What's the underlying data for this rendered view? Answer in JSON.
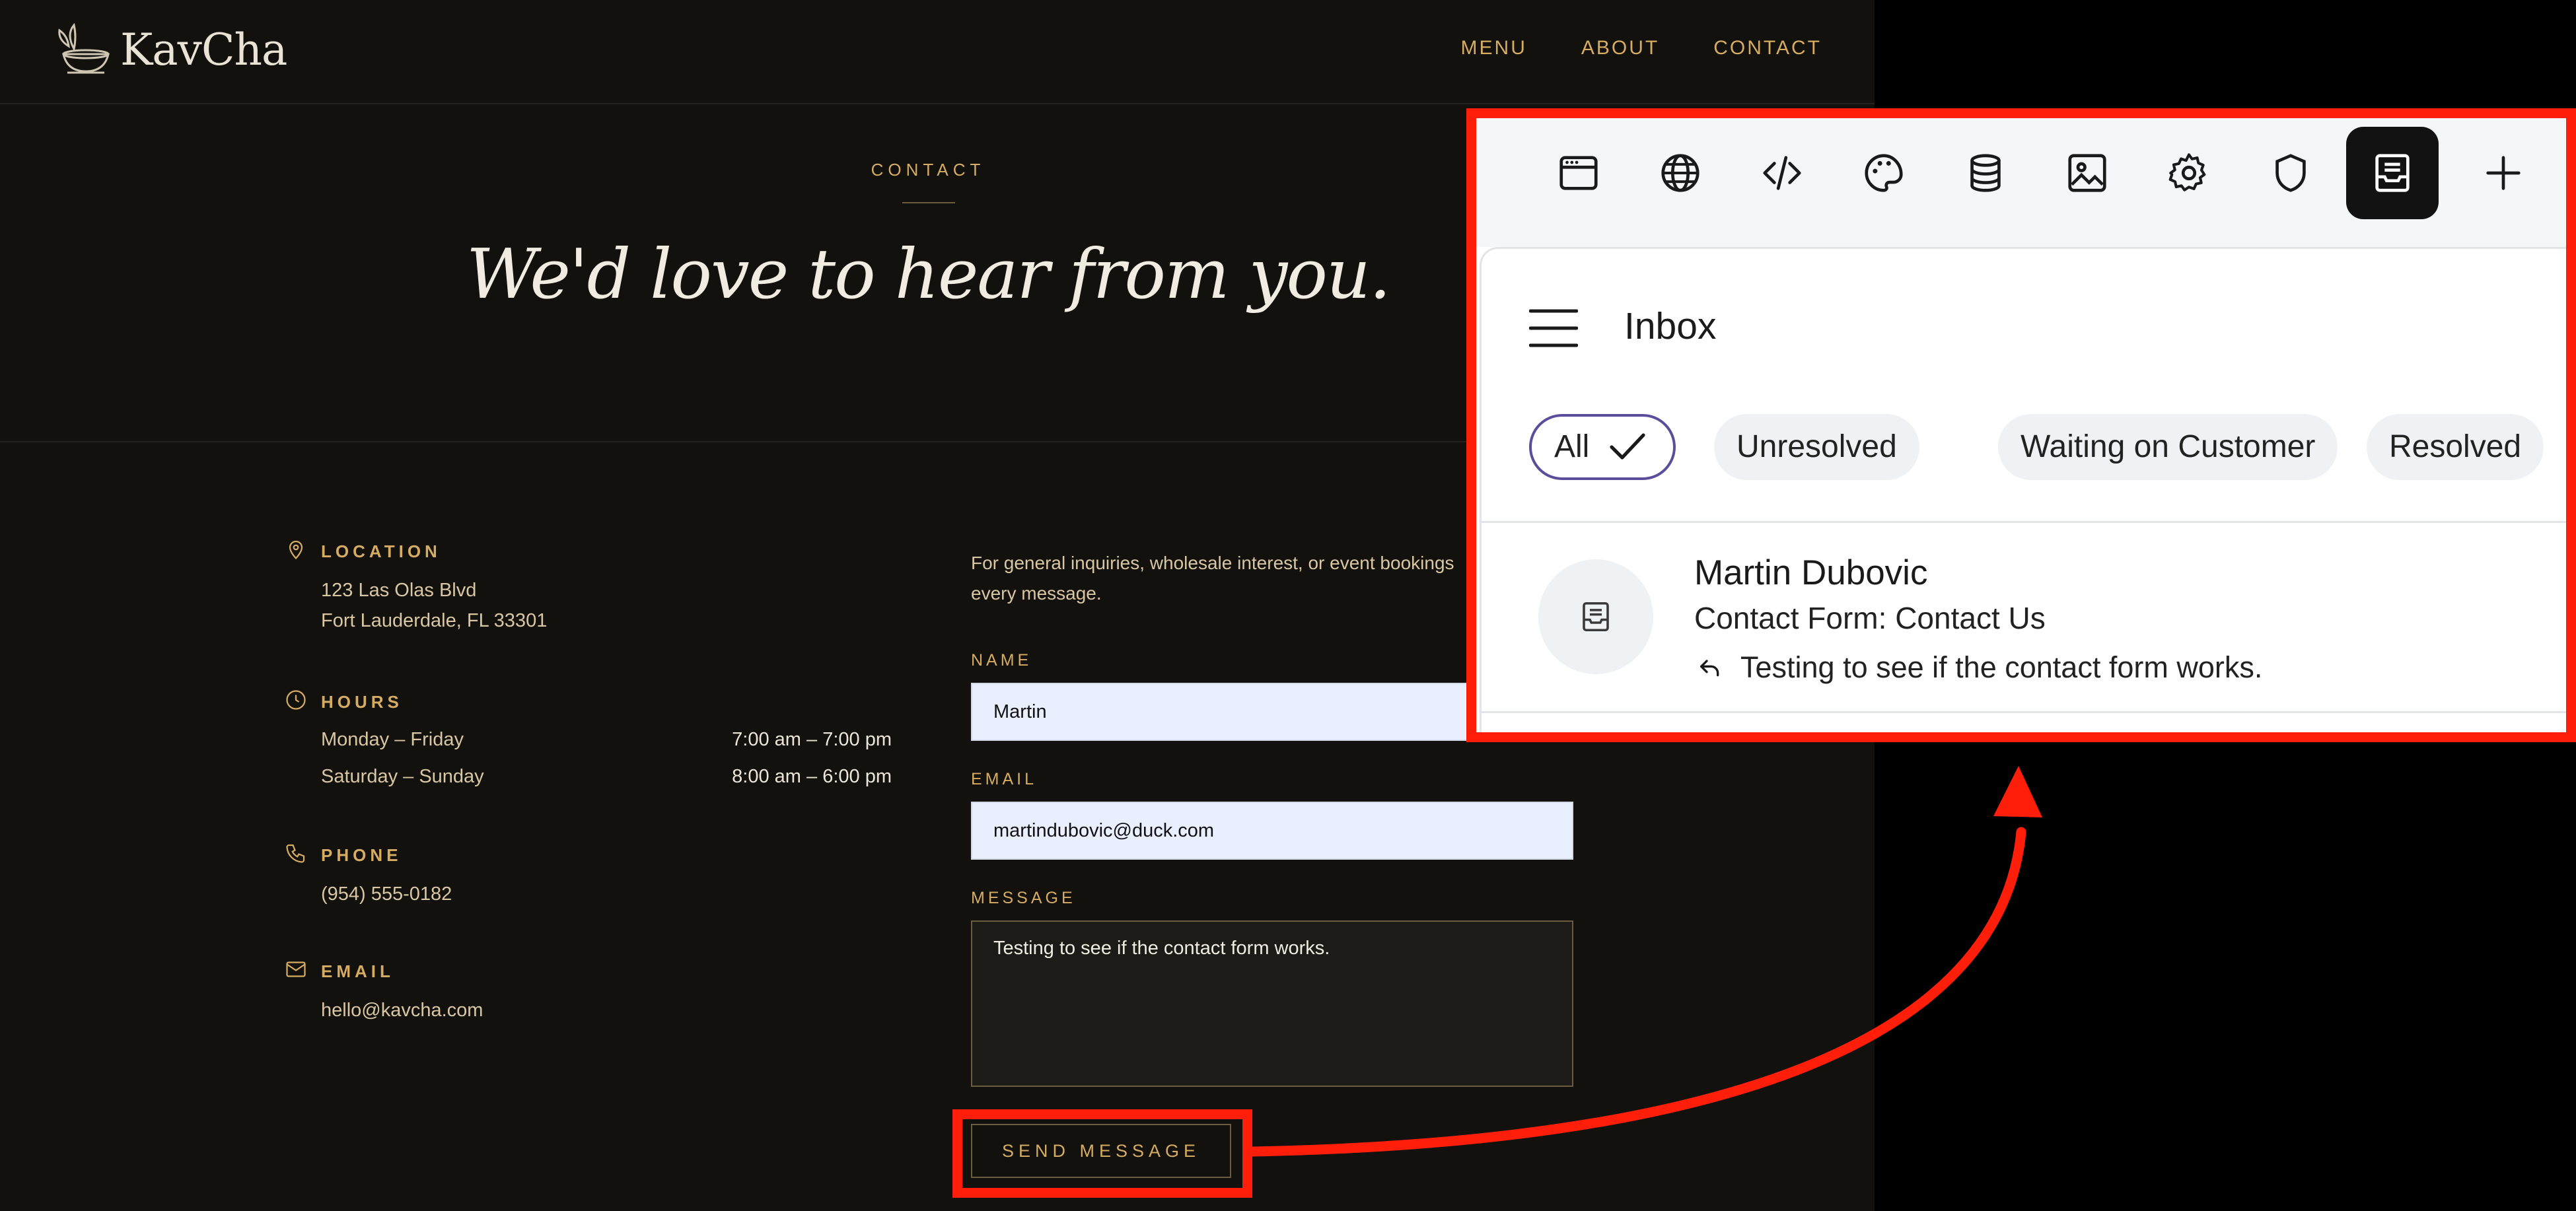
{
  "site": {
    "logo_text": "KavCha",
    "nav": [
      "MENU",
      "ABOUT",
      "CONTACT"
    ],
    "eyebrow": "CONTACT",
    "headline": "We'd love to hear from you.",
    "location": {
      "label": "LOCATION",
      "line1": "123 Las Olas Blvd",
      "line2": "Fort Lauderdale, FL 33301"
    },
    "hours": {
      "label": "HOURS",
      "rows": [
        {
          "days": "Monday – Friday",
          "time": "7:00 am – 7:00 pm"
        },
        {
          "days": "Saturday – Sunday",
          "time": "8:00 am – 6:00 pm"
        }
      ]
    },
    "phone": {
      "label": "PHONE",
      "value": "(954) 555-0182"
    },
    "email": {
      "label": "EMAIL",
      "value": "hello@kavcha.com"
    },
    "form": {
      "intro_line1": "For general inquiries, wholesale interest, or event bookings",
      "intro_line2": "every message.",
      "name_label": "NAME",
      "name_value": "Martin",
      "email_label": "EMAIL",
      "email_value": "martindubovic@duck.com",
      "message_label": "MESSAGE",
      "message_value": "Testing to see if the contact form works.",
      "send_label": "SEND MESSAGE"
    }
  },
  "panel": {
    "toolbar_icons": [
      "browser-icon",
      "globe-icon",
      "code-icon",
      "palette-icon",
      "database-icon",
      "image-icon",
      "gear-icon",
      "shield-icon",
      "inbox-icon",
      "plus-icon"
    ],
    "active_icon": "inbox-icon",
    "title": "Inbox",
    "filters": [
      "All",
      "Unresolved",
      "Waiting on Customer",
      "Resolved"
    ],
    "selected_filter": "All",
    "message": {
      "sender": "Martin Dubovic",
      "subject": "Contact Form: Contact Us",
      "snippet": "Testing to see if the contact form works."
    }
  },
  "annotation": {
    "color": "#ff1e0a"
  }
}
